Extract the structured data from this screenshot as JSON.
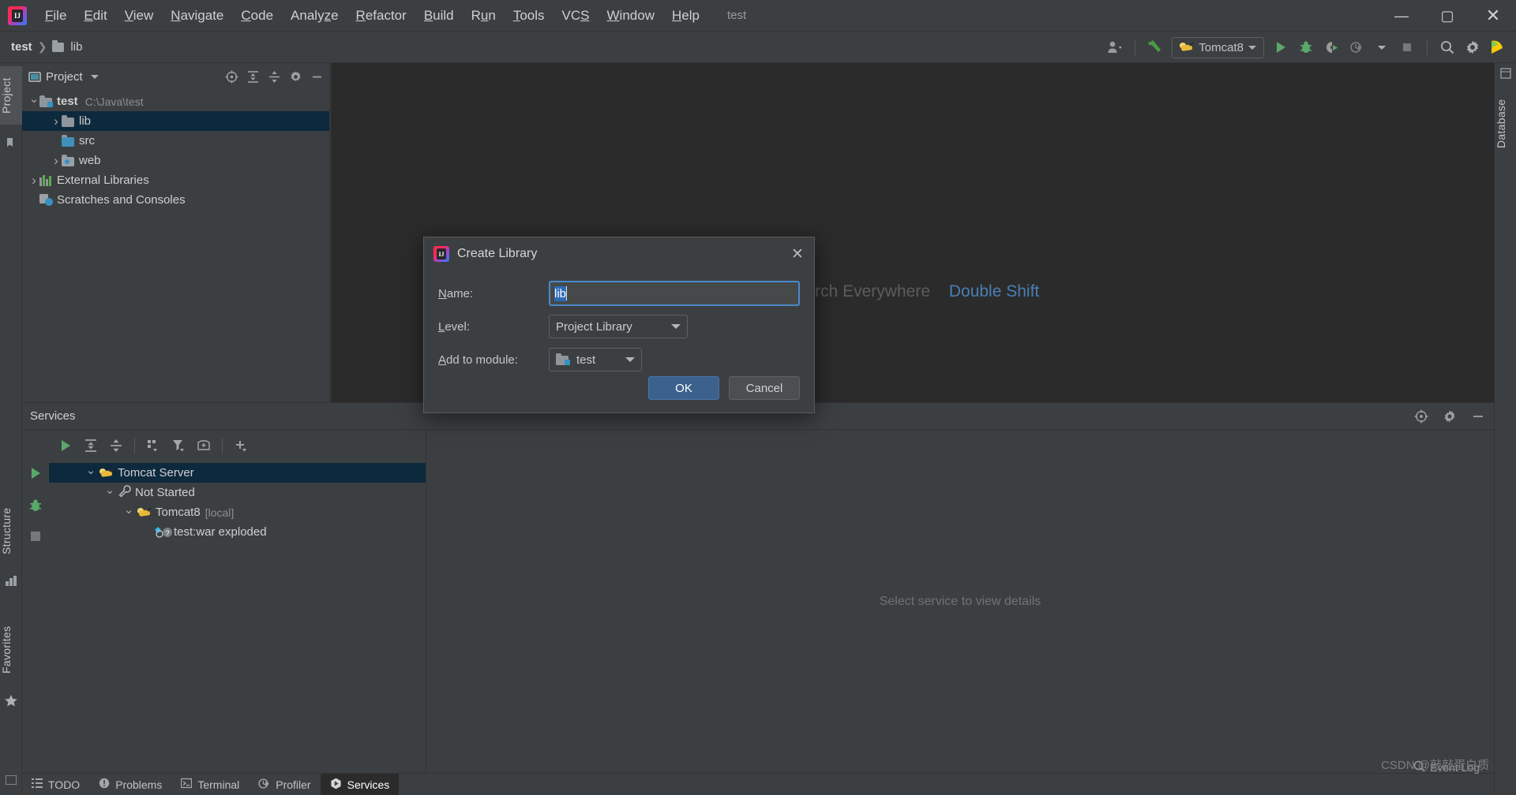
{
  "window": {
    "title": "test",
    "controls": {
      "minimize": "—",
      "maximize": "▢",
      "close": "✕"
    }
  },
  "menu": {
    "items": [
      {
        "label": "File",
        "mnemonic": "F"
      },
      {
        "label": "Edit",
        "mnemonic": "E"
      },
      {
        "label": "View",
        "mnemonic": "V"
      },
      {
        "label": "Navigate",
        "mnemonic": "N"
      },
      {
        "label": "Code",
        "mnemonic": "C"
      },
      {
        "label": "Analyze",
        "mnemonic": "z"
      },
      {
        "label": "Refactor",
        "mnemonic": "R"
      },
      {
        "label": "Build",
        "mnemonic": "B"
      },
      {
        "label": "Run",
        "mnemonic": "u"
      },
      {
        "label": "Tools",
        "mnemonic": "T"
      },
      {
        "label": "VCS",
        "mnemonic": "S"
      },
      {
        "label": "Window",
        "mnemonic": "W"
      },
      {
        "label": "Help",
        "mnemonic": "H"
      }
    ]
  },
  "navbar": {
    "crumbs": [
      "test",
      "lib"
    ],
    "run_config": "Tomcat8",
    "icons": [
      "user-dropdown-icon",
      "hammer-icon",
      "run-icon",
      "debug-icon",
      "run-coverage-icon",
      "profiler-icon",
      "stop-icon",
      "search-everywhere-icon",
      "settings-icon",
      "ide-logo-icon"
    ]
  },
  "left_strip": {
    "tabs": [
      "Project"
    ],
    "bookmarks_icon": "bookmarks-icon"
  },
  "right_strip": {
    "tabs": [
      "Database"
    ]
  },
  "project_panel": {
    "title": "Project",
    "toolbar_icons": [
      "locate-icon",
      "expand-all-icon",
      "collapse-all-icon",
      "settings-icon",
      "hide-icon"
    ],
    "tree": [
      {
        "label": "test",
        "path": "C:\\Java\\test",
        "icon": "module-folder-icon",
        "arrow": "down",
        "indent": 0,
        "bold": true
      },
      {
        "label": "lib",
        "icon": "folder-icon",
        "arrow": "right",
        "indent": 1,
        "selected": true
      },
      {
        "label": "src",
        "icon": "source-folder-icon",
        "arrow": "none",
        "indent": 1
      },
      {
        "label": "web",
        "icon": "web-folder-icon",
        "arrow": "right",
        "indent": 1
      },
      {
        "label": "External Libraries",
        "icon": "libraries-icon",
        "arrow": "right",
        "indent": 0
      },
      {
        "label": "Scratches and Consoles",
        "icon": "scratches-icon",
        "arrow": "none",
        "indent": 0
      }
    ]
  },
  "editor": {
    "hint_prefix": "Search Everywhere",
    "hint_key": "Double Shift"
  },
  "dialog": {
    "title": "Create Library",
    "icon": "intellij-idea-icon",
    "close_label": "✕",
    "fields": {
      "name_label": "Name:",
      "name_mnemonic": "N",
      "name_value": "lib",
      "level_label": "Level:",
      "level_mnemonic": "L",
      "level_value": "Project Library",
      "module_label": "Add to module:",
      "module_mnemonic": "A",
      "module_value": "test"
    },
    "ok_label": "OK",
    "cancel_label": "Cancel",
    "accent_color": "#3c618d"
  },
  "services": {
    "title": "Services",
    "toolbar_icons": [
      "run-icon",
      "expand-all-icon",
      "collapse-all-icon",
      "group-by-icon",
      "filter-icon",
      "add-tab-icon",
      "add-icon"
    ],
    "head_actions": [
      "locate-icon",
      "settings-icon",
      "hide-icon"
    ],
    "gutter_icons": [
      "run-icon",
      "debug-icon",
      "stop-icon"
    ],
    "tree": [
      {
        "label": "Tomcat Server",
        "icon": "tomcat-icon",
        "arrow": "down",
        "indent": 0,
        "selected": true
      },
      {
        "label": "Not Started",
        "icon": "wrench-icon",
        "arrow": "down",
        "indent": 1
      },
      {
        "label": "Tomcat8",
        "suffix": "[local]",
        "icon": "tomcat-icon",
        "arrow": "down",
        "indent": 2
      },
      {
        "label": "test:war exploded",
        "icon": "artifact-icon",
        "arrow": "none",
        "indent": 3
      }
    ],
    "detail_placeholder": "Select service to view details"
  },
  "bottom_tabs": [
    {
      "label": "TODO",
      "icon": "todo-icon",
      "selected": false
    },
    {
      "label": "Problems",
      "icon": "problems-icon",
      "selected": false
    },
    {
      "label": "Terminal",
      "icon": "terminal-icon",
      "selected": false
    },
    {
      "label": "Profiler",
      "icon": "profiler-icon",
      "selected": false
    },
    {
      "label": "Services",
      "icon": "services-icon",
      "selected": true
    }
  ],
  "status": {
    "event_log": "Event Log",
    "watermark": "CSDN @敲敲蛋白质"
  }
}
